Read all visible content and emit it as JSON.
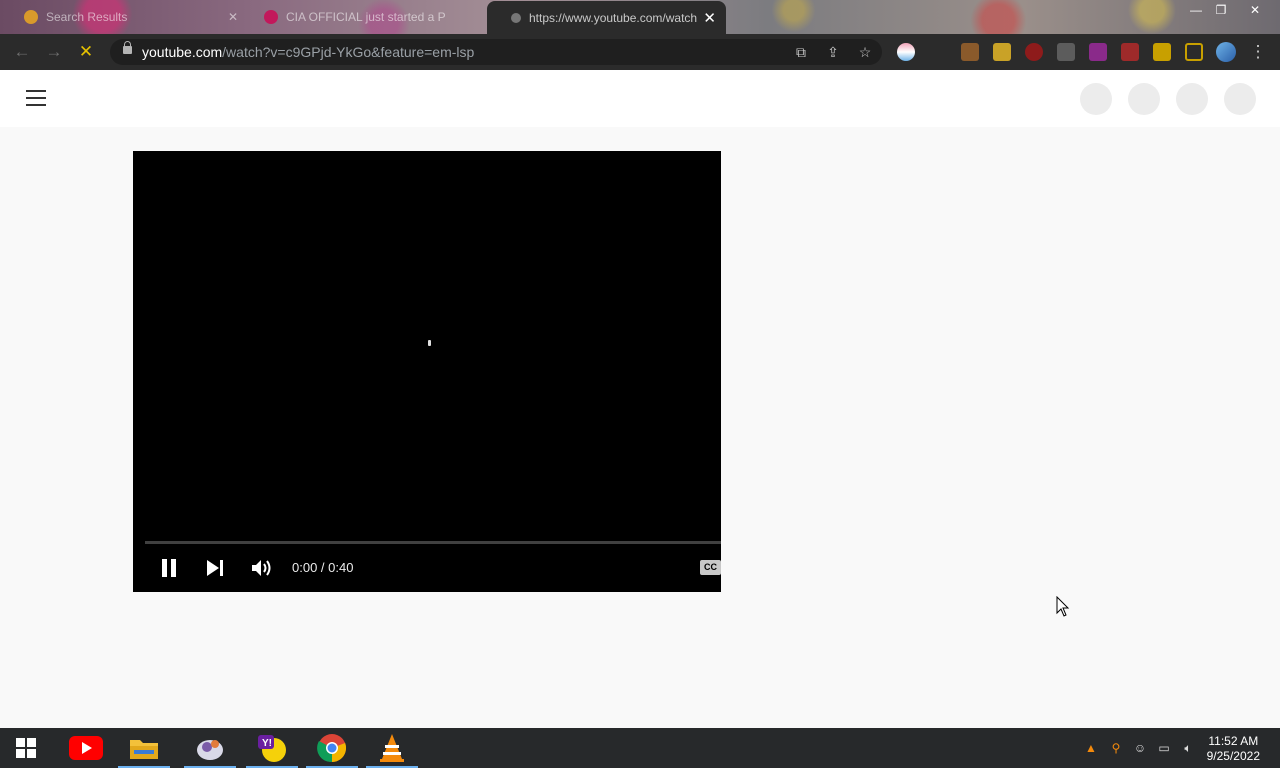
{
  "browser": {
    "tabs": [
      {
        "title": "Search Results",
        "active": false
      },
      {
        "title": "CIA OFFICIAL just started a P",
        "active": false
      },
      {
        "title": "https://www.youtube.com/watch",
        "active": true
      }
    ],
    "url_host": "youtube.com",
    "url_path": "/watch?v=c9GPjd-YkGo&feature=em-lsp",
    "window_buttons": {
      "minimize": "—",
      "restore": "❐",
      "close": "✕"
    }
  },
  "player": {
    "time_display": "0:00 / 0:40",
    "cc_label": "CC",
    "state": "playing"
  },
  "taskbar": {
    "apps": [
      "windows-start",
      "youtube",
      "file-explorer",
      "pinned-app",
      "yahoo-messenger",
      "chrome",
      "vlc"
    ],
    "clock_time": "11:52 AM",
    "clock_date": "9/25/2022"
  },
  "colors": {
    "toolbar_bg": "#2b2b2b",
    "page_bg": "#f9f9f9",
    "player_bg": "#000000",
    "taskbar_bg": "#27292b",
    "youtube_red": "#ff0000"
  }
}
